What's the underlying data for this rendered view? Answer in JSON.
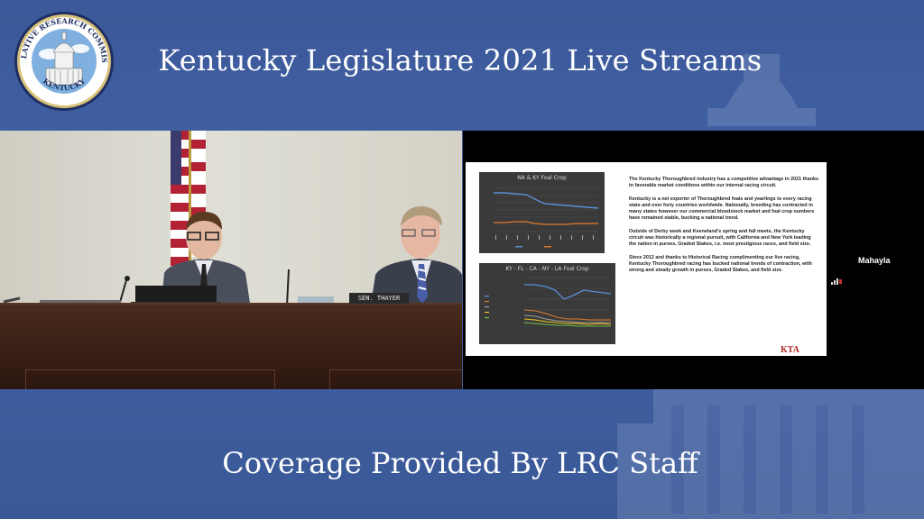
{
  "header": {
    "seal_text_top": "LEGISLATIVE RESEARCH COMMISSION",
    "seal_text_bottom": "KENTUCKY",
    "title": "Kentucky Legislature 2021 Live Streams"
  },
  "camera": {
    "nameplate": "SEN. THAYER"
  },
  "slide": {
    "chart1_title": "NA & KY Foal Crop",
    "chart2_title": "KY - FL - CA - NY - LA Foal Crop",
    "paragraphs": [
      "The Kentucky Thoroughbred industry has a competitive advantage in 2021 thanks to favorable market conditions within our internal racing circuit.",
      "Kentucky is a net exporter of Thoroughbred foals and yearlings to every racing state and over forty countries worldwide. Nationally, breeding has contracted in many states however our commercial bloodstock market and foal crop numbers have remained stable, bucking a national trend.",
      "Outside of Derby week and Keeneland's spring and fall meets, the Kentucky circuit was historically a regional pursuit, with California and New York leading the nation in purses, Graded Stakes, i.e. most prestigious races, and field size.",
      "Since 2012 and thanks to Historical Racing complimenting our live racing, Kentucky Thoroughbred racing has bucked national trends of contraction, with strong and steady growth in purses, Graded Stakes, and field size."
    ],
    "logo": "KTA"
  },
  "participant": {
    "name": "Mahayla"
  },
  "footer": {
    "text": "Coverage Provided By LRC Staff"
  },
  "colors": {
    "banner_blue": "#3f5c9d",
    "slide_chart_bg": "#3a3a3a",
    "kta_red": "#b0231f"
  }
}
